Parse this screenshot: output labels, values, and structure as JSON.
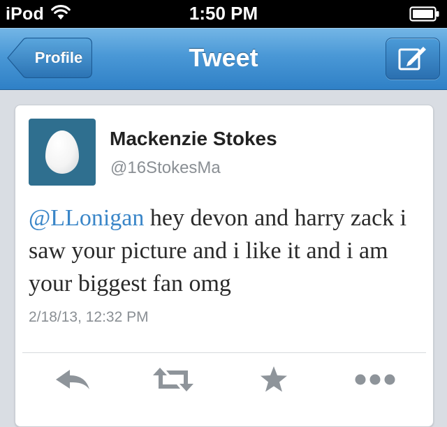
{
  "status_bar": {
    "carrier": "iPod",
    "time": "1:50 PM"
  },
  "nav": {
    "back_label": "Profile",
    "title": "Tweet"
  },
  "tweet": {
    "display_name": "Mackenzie Stokes",
    "handle": "@16StokesMa",
    "mention": "@LLonigan",
    "text": " hey devon and harry zack i saw your picture and i like it and i am your biggest fan omg",
    "timestamp": "2/18/13, 12:32 PM"
  },
  "colors": {
    "nav_blue": "#4a98d6",
    "mention_blue": "#3a86c8",
    "avatar_bg": "#2f6f8f",
    "action_gray": "#8e949a"
  },
  "icons": {
    "status": [
      "wifi-icon",
      "battery-icon"
    ],
    "nav": [
      "compose-icon"
    ],
    "actions": [
      "reply-icon",
      "retweet-icon",
      "favorite-star-icon",
      "more-dots-icon"
    ]
  }
}
